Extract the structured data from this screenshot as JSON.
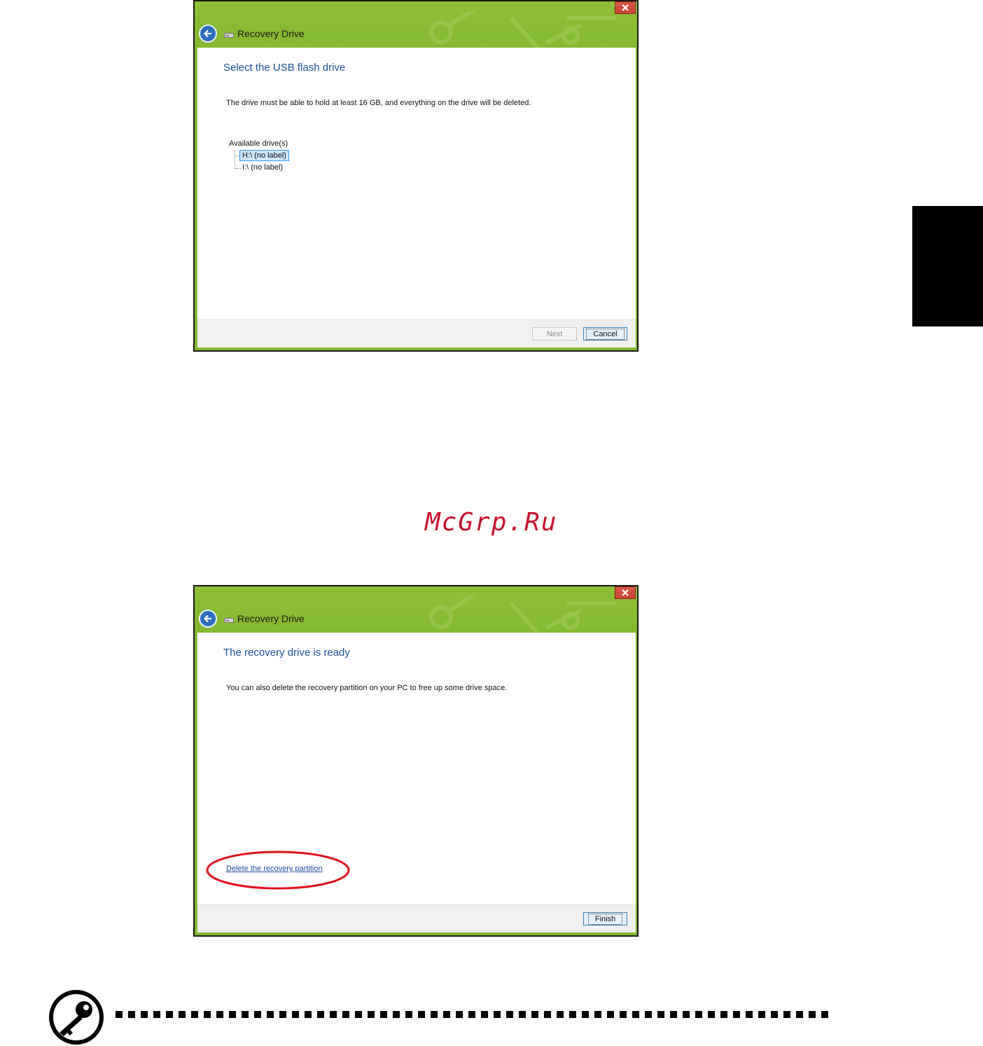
{
  "window1": {
    "title": "Recovery Drive",
    "heading": "Select the USB flash drive",
    "description": "The drive must be able to hold at least 16 GB, and everything on the drive will be deleted.",
    "tree_root": "Available drive(s)",
    "drives": [
      "H:\\ (no label)",
      "I:\\ (no label)"
    ],
    "selected_drive": "H:\\ (no label)",
    "next_label": "Next",
    "cancel_label": "Cancel"
  },
  "window2": {
    "title": "Recovery Drive",
    "heading": "The recovery drive is ready",
    "description": "You can also delete the recovery partition on your PC to free up some drive space.",
    "link_text": "Delete the recovery partition",
    "finish_label": "Finish"
  },
  "watermark": "McGrp.Ru",
  "colors": {
    "titlebar_green": "#85b934",
    "heading_blue": "#1c4f9c",
    "highlight_red": "#e0121c",
    "close_red": "#c7402f"
  }
}
